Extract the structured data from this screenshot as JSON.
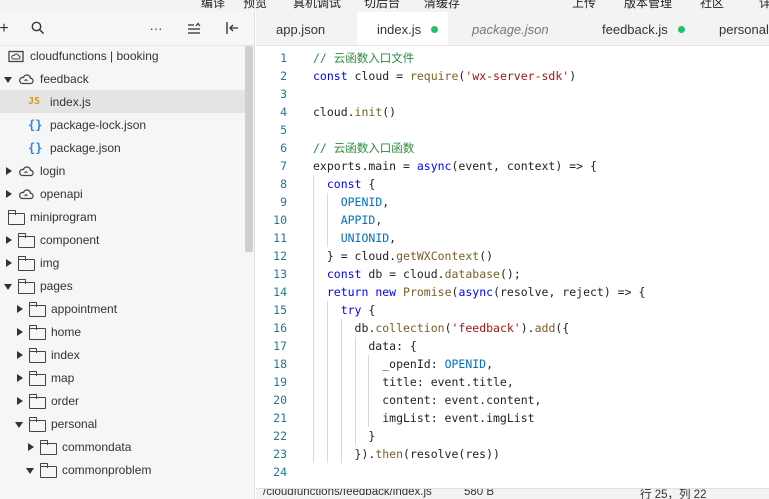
{
  "top_menu": {
    "items": [
      "编译",
      "预览",
      "真机调试",
      "切后台",
      "清缓存",
      "上传",
      "版本管理",
      "社区",
      "详"
    ]
  },
  "explorer": {
    "toolbar": {
      "add": "+",
      "more": "···"
    },
    "tree": [
      {
        "label": "cloudfunctions | booking",
        "icon": "cloud-folder-icon",
        "depth": 0,
        "arrow": "none"
      },
      {
        "label": "feedback",
        "icon": "cloud-icon",
        "depth": 0,
        "arrow": "down"
      },
      {
        "label": "index.js",
        "icon": "js-file-icon",
        "depth": 1,
        "arrow": "none",
        "selected": true
      },
      {
        "label": "package-lock.json",
        "icon": "json-file-icon",
        "depth": 1,
        "arrow": "none"
      },
      {
        "label": "package.json",
        "icon": "json-file-icon",
        "depth": 1,
        "arrow": "none"
      },
      {
        "label": "login",
        "icon": "cloud-icon",
        "depth": 0,
        "arrow": "right"
      },
      {
        "label": "openapi",
        "icon": "cloud-icon",
        "depth": 0,
        "arrow": "right"
      },
      {
        "label": "miniprogram",
        "icon": "folder-icon",
        "depth": 0,
        "arrow": "none"
      },
      {
        "label": "component",
        "icon": "folder-icon",
        "depth": 0,
        "arrow": "right"
      },
      {
        "label": "img",
        "icon": "folder-icon",
        "depth": 0,
        "arrow": "right"
      },
      {
        "label": "pages",
        "icon": "folder-icon",
        "depth": 0,
        "arrow": "down"
      },
      {
        "label": "appointment",
        "icon": "folder-icon",
        "depth": 1,
        "arrow": "right"
      },
      {
        "label": "home",
        "icon": "folder-icon",
        "depth": 1,
        "arrow": "right"
      },
      {
        "label": "index",
        "icon": "folder-icon",
        "depth": 1,
        "arrow": "right"
      },
      {
        "label": "map",
        "icon": "folder-icon",
        "depth": 1,
        "arrow": "right"
      },
      {
        "label": "order",
        "icon": "folder-icon",
        "depth": 1,
        "arrow": "right"
      },
      {
        "label": "personal",
        "icon": "folder-icon",
        "depth": 1,
        "arrow": "down"
      },
      {
        "label": "commondata",
        "icon": "folder-icon",
        "depth": 2,
        "arrow": "right"
      },
      {
        "label": "commonproblem",
        "icon": "folder-icon",
        "depth": 2,
        "arrow": "down"
      }
    ]
  },
  "editor": {
    "tabs": [
      {
        "label": "app.json",
        "active": false,
        "preview": false,
        "modified": false
      },
      {
        "label": "index.js",
        "active": true,
        "preview": false,
        "modified": true
      },
      {
        "label": "package.json",
        "active": false,
        "preview": true,
        "modified": false
      },
      {
        "label": "feedback.js",
        "active": false,
        "preview": false,
        "modified": true
      },
      {
        "label": "personal",
        "active": false,
        "preview": false,
        "modified": false
      }
    ],
    "lines": [
      {
        "n": "1",
        "tokens": [
          [
            "c",
            "// 云函数入口文件"
          ]
        ]
      },
      {
        "n": "2",
        "tokens": [
          [
            "k",
            "const "
          ],
          [
            "p",
            "cloud = "
          ],
          [
            "f",
            "require"
          ],
          [
            "p",
            "("
          ],
          [
            "s",
            "'wx-server-sdk'"
          ],
          [
            "p",
            ")"
          ]
        ]
      },
      {
        "n": "3",
        "tokens": []
      },
      {
        "n": "4",
        "tokens": [
          [
            "p",
            "cloud."
          ],
          [
            "f",
            "init"
          ],
          [
            "p",
            "()"
          ]
        ]
      },
      {
        "n": "5",
        "tokens": []
      },
      {
        "n": "6",
        "tokens": [
          [
            "c",
            "// 云函数入口函数"
          ]
        ]
      },
      {
        "n": "7",
        "tokens": [
          [
            "p",
            "exports.main = "
          ],
          [
            "k",
            "async"
          ],
          [
            "p",
            "(event, context) => {"
          ]
        ]
      },
      {
        "n": "8",
        "tokens": [
          [
            "p",
            "  "
          ],
          [
            "k",
            "const "
          ],
          [
            "p",
            "{"
          ]
        ]
      },
      {
        "n": "9",
        "tokens": [
          [
            "p",
            "    "
          ],
          [
            "v",
            "OPENID"
          ],
          [
            "p",
            ","
          ]
        ]
      },
      {
        "n": "10",
        "tokens": [
          [
            "p",
            "    "
          ],
          [
            "v",
            "APPID"
          ],
          [
            "p",
            ","
          ]
        ]
      },
      {
        "n": "11",
        "tokens": [
          [
            "p",
            "    "
          ],
          [
            "v",
            "UNIONID"
          ],
          [
            "p",
            ","
          ]
        ]
      },
      {
        "n": "12",
        "tokens": [
          [
            "p",
            "  } = cloud."
          ],
          [
            "f",
            "getWXContext"
          ],
          [
            "p",
            "()"
          ]
        ]
      },
      {
        "n": "13",
        "tokens": [
          [
            "p",
            "  "
          ],
          [
            "k",
            "const "
          ],
          [
            "p",
            "db = cloud."
          ],
          [
            "f",
            "database"
          ],
          [
            "p",
            "();"
          ]
        ]
      },
      {
        "n": "14",
        "tokens": [
          [
            "p",
            "  "
          ],
          [
            "k",
            "return new "
          ],
          [
            "f",
            "Promise"
          ],
          [
            "p",
            "("
          ],
          [
            "k",
            "async"
          ],
          [
            "p",
            "(resolve, reject) => {"
          ]
        ]
      },
      {
        "n": "15",
        "tokens": [
          [
            "p",
            "    "
          ],
          [
            "k",
            "try "
          ],
          [
            "p",
            "{"
          ]
        ]
      },
      {
        "n": "16",
        "tokens": [
          [
            "p",
            "      db."
          ],
          [
            "f",
            "collection"
          ],
          [
            "p",
            "("
          ],
          [
            "s",
            "'feedback'"
          ],
          [
            "p",
            ")."
          ],
          [
            "f",
            "add"
          ],
          [
            "p",
            "({"
          ]
        ]
      },
      {
        "n": "17",
        "tokens": [
          [
            "p",
            "        data: {"
          ]
        ]
      },
      {
        "n": "18",
        "tokens": [
          [
            "p",
            "          _openId: "
          ],
          [
            "v",
            "OPENID"
          ],
          [
            "p",
            ","
          ]
        ]
      },
      {
        "n": "19",
        "tokens": [
          [
            "p",
            "          title: event.title,"
          ]
        ]
      },
      {
        "n": "20",
        "tokens": [
          [
            "p",
            "          content: event.content,"
          ]
        ]
      },
      {
        "n": "21",
        "tokens": [
          [
            "p",
            "          imgList: event.imgList"
          ]
        ]
      },
      {
        "n": "22",
        "tokens": [
          [
            "p",
            "        }"
          ]
        ]
      },
      {
        "n": "23",
        "tokens": [
          [
            "p",
            "      })."
          ],
          [
            "f",
            "then"
          ],
          [
            "p",
            "(resolve(res))"
          ]
        ]
      },
      {
        "n": "24",
        "tokens": []
      }
    ]
  },
  "status_bar": {
    "path": "/cloudfunctions/feedback/index.js",
    "size": "580 B",
    "position": "行 25，列 22"
  },
  "colors": {
    "comment": "#2b8c3a",
    "keyword": "#0000ff",
    "string": "#a31515",
    "variable": "#0070c1",
    "function": "#795e26",
    "line_number": "#237893",
    "modified_dot": "#1fc36a"
  }
}
